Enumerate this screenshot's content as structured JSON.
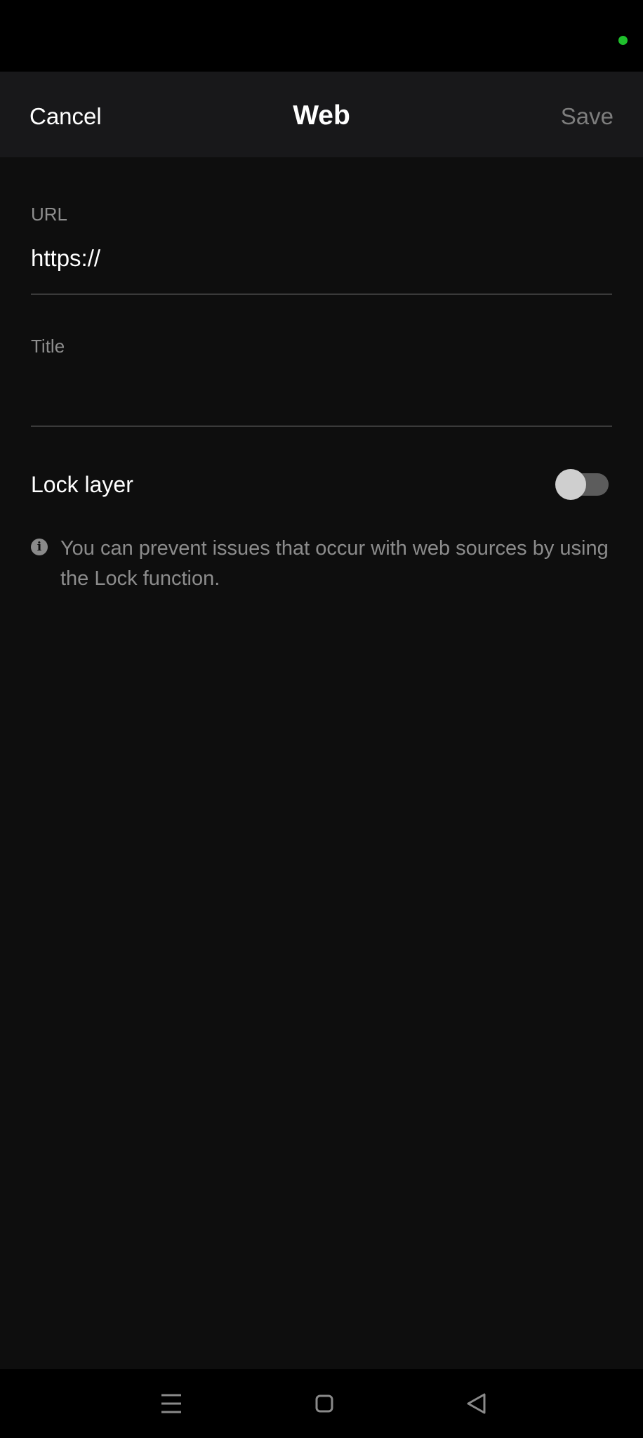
{
  "header": {
    "cancel_label": "Cancel",
    "title": "Web",
    "save_label": "Save"
  },
  "form": {
    "url": {
      "label": "URL",
      "value": "https://"
    },
    "title": {
      "label": "Title",
      "value": ""
    },
    "lock_layer": {
      "label": "Lock layer",
      "enabled": false
    },
    "info": {
      "icon": "info-icon",
      "text": "You can prevent issues that occur with web sources by using the Lock function."
    }
  },
  "status_bar": {
    "indicator_color": "#1fc02c"
  },
  "nav_bar": {
    "buttons": [
      "menu-icon",
      "home-icon",
      "back-icon"
    ]
  },
  "colors": {
    "background": "#0e0e0e",
    "app_bar": "#18181a",
    "text_primary": "#ffffff",
    "text_secondary": "#8c8c8c",
    "save_disabled": "#7d7d7d"
  }
}
